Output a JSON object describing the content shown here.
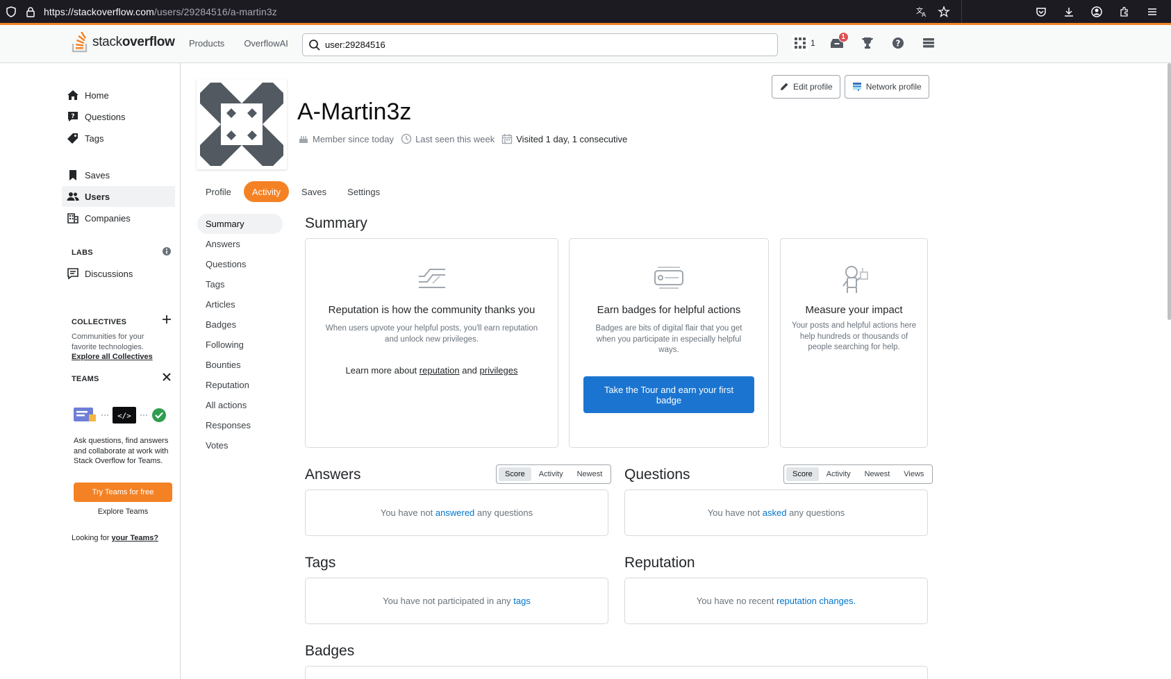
{
  "browser": {
    "url_host": "https://stackoverflow.com",
    "url_path": "/users/29284516/a-martin3z"
  },
  "topbar": {
    "logo_plain": "stack",
    "logo_bold": "overflow",
    "nav": [
      "Products",
      "OverflowAI"
    ],
    "search_value": "user:29284516",
    "reputation": "1",
    "inbox_count": "1"
  },
  "sidebar": {
    "items": [
      {
        "label": "Home",
        "icon": "home-icon"
      },
      {
        "label": "Questions",
        "icon": "questions-icon"
      },
      {
        "label": "Tags",
        "icon": "tag-icon"
      },
      {
        "label": "Saves",
        "icon": "bookmark-icon"
      },
      {
        "label": "Users",
        "icon": "users-icon"
      },
      {
        "label": "Companies",
        "icon": "building-icon"
      }
    ],
    "labs_title": "LABS",
    "discussions": "Discussions",
    "collectives_title": "COLLECTIVES",
    "collectives_desc_1": "Communities for your",
    "collectives_desc_2": "favorite technologies.",
    "collectives_link": "Explore all Collectives",
    "teams_title": "TEAMS",
    "teams_desc": "Ask questions, find answers and collaborate at work with Stack Overflow for Teams.",
    "try_teams": "Try Teams for free",
    "explore_teams": "Explore Teams",
    "looking_prefix": "Looking for ",
    "looking_link": "your Teams?"
  },
  "profile": {
    "name": "A-Martin3z",
    "member_since": "Member since today",
    "last_seen": "Last seen this week",
    "visited": "Visited 1 day, 1 consecutive",
    "edit_profile": "Edit profile",
    "network_profile": "Network profile"
  },
  "tabs": [
    "Profile",
    "Activity",
    "Saves",
    "Settings"
  ],
  "subnav": [
    "Summary",
    "Answers",
    "Questions",
    "Tags",
    "Articles",
    "Badges",
    "Following",
    "Bounties",
    "Reputation",
    "All actions",
    "Responses",
    "Votes"
  ],
  "summary": {
    "title": "Summary",
    "card1": {
      "title": "Reputation is how the community thanks you",
      "text": "When users upvote your helpful posts, you'll earn reputation and unlock new privileges.",
      "more_prefix": "Learn more about ",
      "more_link1": "reputation",
      "more_and": " and ",
      "more_link2": "privileges"
    },
    "card2": {
      "title": "Earn badges for helpful actions",
      "text": "Badges are bits of digital flair that you get when you participate in especially helpful ways.",
      "button": "Take the Tour and earn your first badge"
    },
    "card3": {
      "title": "Measure your impact",
      "text": "Your posts and helpful actions here help hundreds or thousands of people searching for help."
    }
  },
  "answers": {
    "title": "Answers",
    "sort": [
      "Score",
      "Activity",
      "Newest"
    ],
    "empty_prefix": "You have not ",
    "empty_link": "answered",
    "empty_suffix": " any questions"
  },
  "questions": {
    "title": "Questions",
    "sort": [
      "Score",
      "Activity",
      "Newest",
      "Views"
    ],
    "empty_prefix": "You have not ",
    "empty_link": "asked",
    "empty_suffix": " any questions"
  },
  "tags_section": {
    "title": "Tags",
    "empty_prefix": "You have not participated in any ",
    "empty_link": "tags"
  },
  "reputation_section": {
    "title": "Reputation",
    "empty_prefix": "You have no recent ",
    "empty_link": "reputation changes."
  },
  "badges_section": {
    "title": "Badges"
  },
  "colors": {
    "accent": "#f48225",
    "link": "#0074cc",
    "button_blue": "#1b75d0"
  }
}
